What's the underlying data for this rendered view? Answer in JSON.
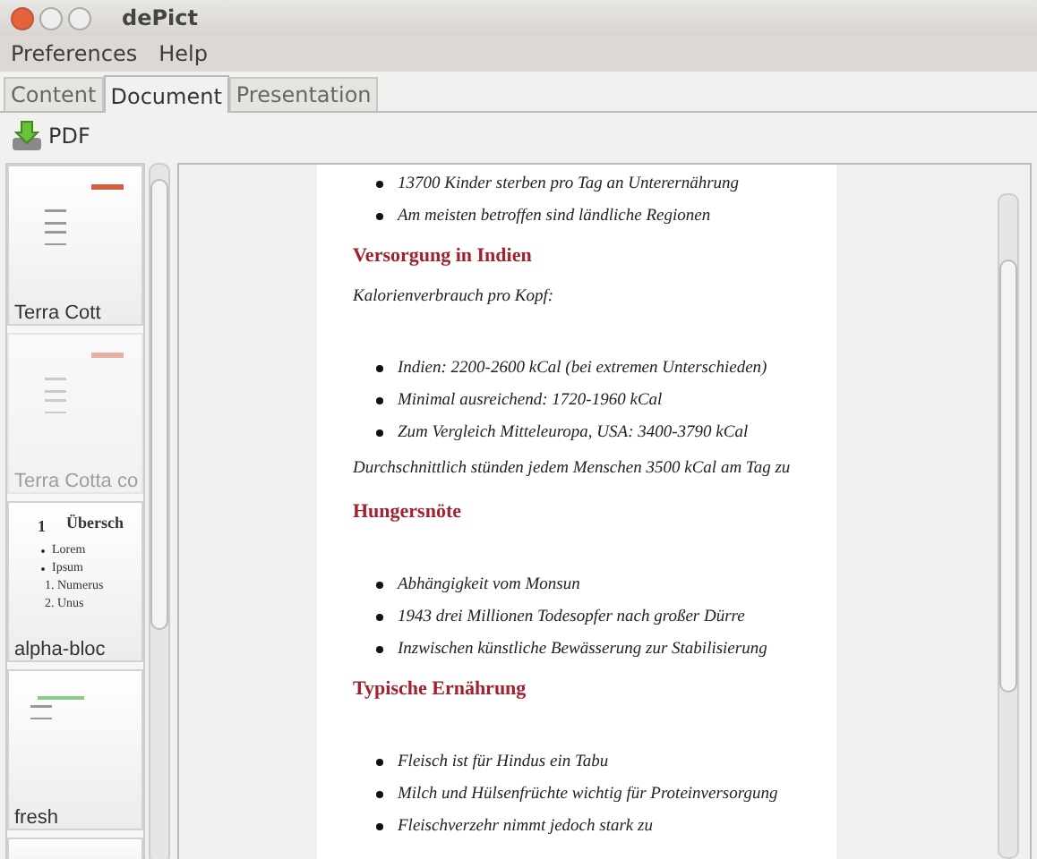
{
  "window": {
    "title": "dePict"
  },
  "menu": [
    "Preferences",
    "Help"
  ],
  "tabs": [
    {
      "label": "Content",
      "selected": false
    },
    {
      "label": "Document",
      "selected": true
    },
    {
      "label": "Presentation",
      "selected": false
    }
  ],
  "toolbar": {
    "pdf_label": "PDF"
  },
  "themes": [
    {
      "label": "Terra Cott",
      "disabled": false
    },
    {
      "label": "Terra Cotta co",
      "disabled": true
    },
    {
      "label": "alpha-bloc",
      "disabled": false,
      "preview": {
        "number": "1",
        "heading": "Übersch",
        "bullets": [
          "Lorem",
          "Ipsum"
        ],
        "numbered": [
          "1. Numerus",
          "2. Unus"
        ]
      }
    },
    {
      "label": "fresh",
      "disabled": false
    }
  ],
  "document": [
    {
      "kind": "bullet",
      "text": "13700 Kinder sterben pro Tag an Unterernährung"
    },
    {
      "kind": "bullet",
      "text": "Am meisten betroffen sind ländliche Regionen"
    },
    {
      "kind": "heading",
      "text": "Versorgung in Indien"
    },
    {
      "kind": "para",
      "text": "Kalorienverbrauch pro Kopf:"
    },
    {
      "kind": "gap"
    },
    {
      "kind": "bullet",
      "text": "Indien: 2200-2600 kCal (bei extremen Unterschieden)"
    },
    {
      "kind": "bullet",
      "text": "Minimal ausreichend: 1720-1960 kCal"
    },
    {
      "kind": "bullet",
      "text": "Zum Vergleich Mitteleuropa, USA: 3400-3790 kCal"
    },
    {
      "kind": "para",
      "text": "Durchschnittlich stünden jedem Menschen 3500 kCal am Tag zu"
    },
    {
      "kind": "heading",
      "text": "Hungersnöte"
    },
    {
      "kind": "gap"
    },
    {
      "kind": "bullet",
      "text": "Abhängigkeit vom Monsun"
    },
    {
      "kind": "bullet",
      "text": "1943 drei Millionen Todesopfer nach großer Dürre"
    },
    {
      "kind": "bullet",
      "text": "Inzwischen künstliche Bewässerung zur Stabilisierung"
    },
    {
      "kind": "heading",
      "text": "Typische Ernährung"
    },
    {
      "kind": "gap"
    },
    {
      "kind": "bullet",
      "text": "Fleisch ist für Hindus ein Tabu"
    },
    {
      "kind": "bullet",
      "text": "Milch und Hülsenfrüchte wichtig für Proteinversorgung"
    },
    {
      "kind": "bullet",
      "text": "Fleischverzehr nimmt jedoch stark zu"
    }
  ]
}
